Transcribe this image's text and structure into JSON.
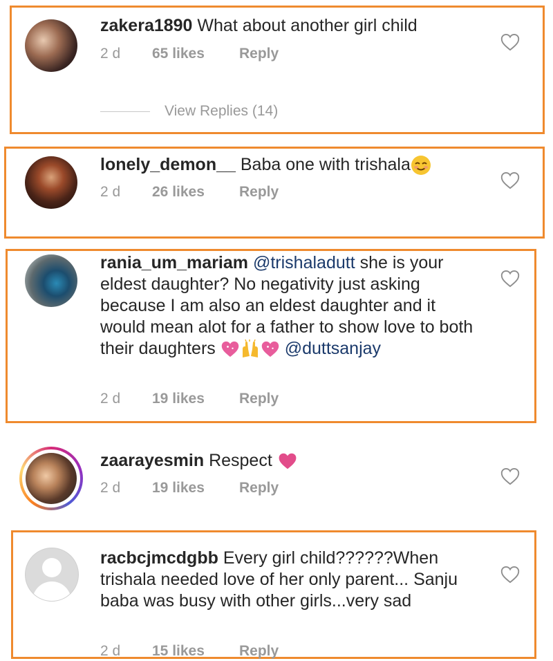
{
  "comments": [
    {
      "username": "zakera1890",
      "text": "What about another girl child",
      "time": "2 d",
      "likes": "65 likes",
      "reply": "Reply",
      "view_replies": "View Replies (14)"
    },
    {
      "username": "lonely_demon__",
      "text": "Baba one with trishala",
      "emoji": "smiling-face-emoji",
      "time": "2 d",
      "likes": "26 likes",
      "reply": "Reply"
    },
    {
      "username": "rania_um_mariam",
      "mention1": "@trishaladutt",
      "text": "she is your eldest daughter? No negativity just asking because I am also an eldest daughter and it would mean alot for a father to show love to both their daughters",
      "emojis": [
        "sparkling-heart-emoji",
        "raised-hands-emoji",
        "sparkling-heart-emoji"
      ],
      "mention2": "@duttsanjay",
      "time": "2 d",
      "likes": "19 likes",
      "reply": "Reply"
    },
    {
      "username": "zaarayesmin",
      "text": "Respect",
      "emoji": "pink-heart-emoji",
      "time": "2 d",
      "likes": "19 likes",
      "reply": "Reply"
    },
    {
      "username": "racbcjmcdgbb",
      "text": "Every girl child??????When trishala needed love of her  only parent... Sanju baba was busy with other  girls...very sad",
      "time": "2 d",
      "likes": "15 likes",
      "reply": "Reply"
    }
  ],
  "colors": {
    "highlight_border": "#ef8a2e",
    "meta_text": "#999999",
    "mention": "#1b3a6b"
  }
}
